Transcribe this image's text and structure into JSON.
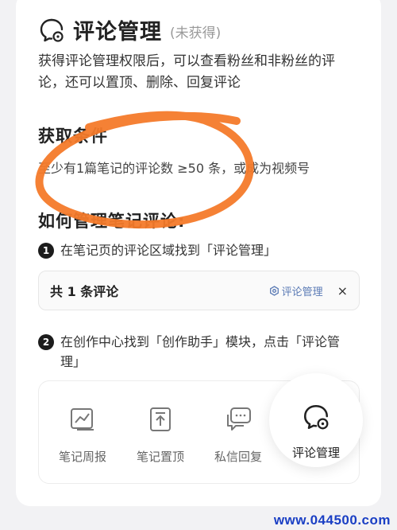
{
  "header": {
    "icon": "comment-management-icon",
    "title": "评论管理",
    "status": "(未获得)"
  },
  "description": "获得评论管理权限后，可以查看粉丝和非粉丝的评论，还可以置顶、删除、回复评论",
  "conditions": {
    "title": "获取条件",
    "text": "至少有1篇笔记的评论数 ≥50 条，或成为视频号"
  },
  "how_to": {
    "title": "如何管理笔记评论:",
    "steps": [
      {
        "num": "1",
        "text": "在笔记页的评论区域找到「评论管理」"
      },
      {
        "num": "2",
        "text": "在创作中心找到「创作助手」模块，点击「评论管理」"
      }
    ]
  },
  "comment_box": {
    "count_label": "共 1 条评论",
    "manage_label": "评论管理",
    "close_label": "×"
  },
  "tools": [
    {
      "label": "笔记周报",
      "icon": "weekly-report-icon"
    },
    {
      "label": "笔记置顶",
      "icon": "pin-top-icon"
    },
    {
      "label": "私信回复",
      "icon": "message-reply-icon"
    },
    {
      "label": "评论管理",
      "icon": "comment-management-icon",
      "highlighted": true
    }
  ],
  "colors": {
    "annotation_stroke": "#f47a2a",
    "link": "#5b7bb5",
    "watermark": "#1a3fc4"
  },
  "watermark": "www.044500.com"
}
